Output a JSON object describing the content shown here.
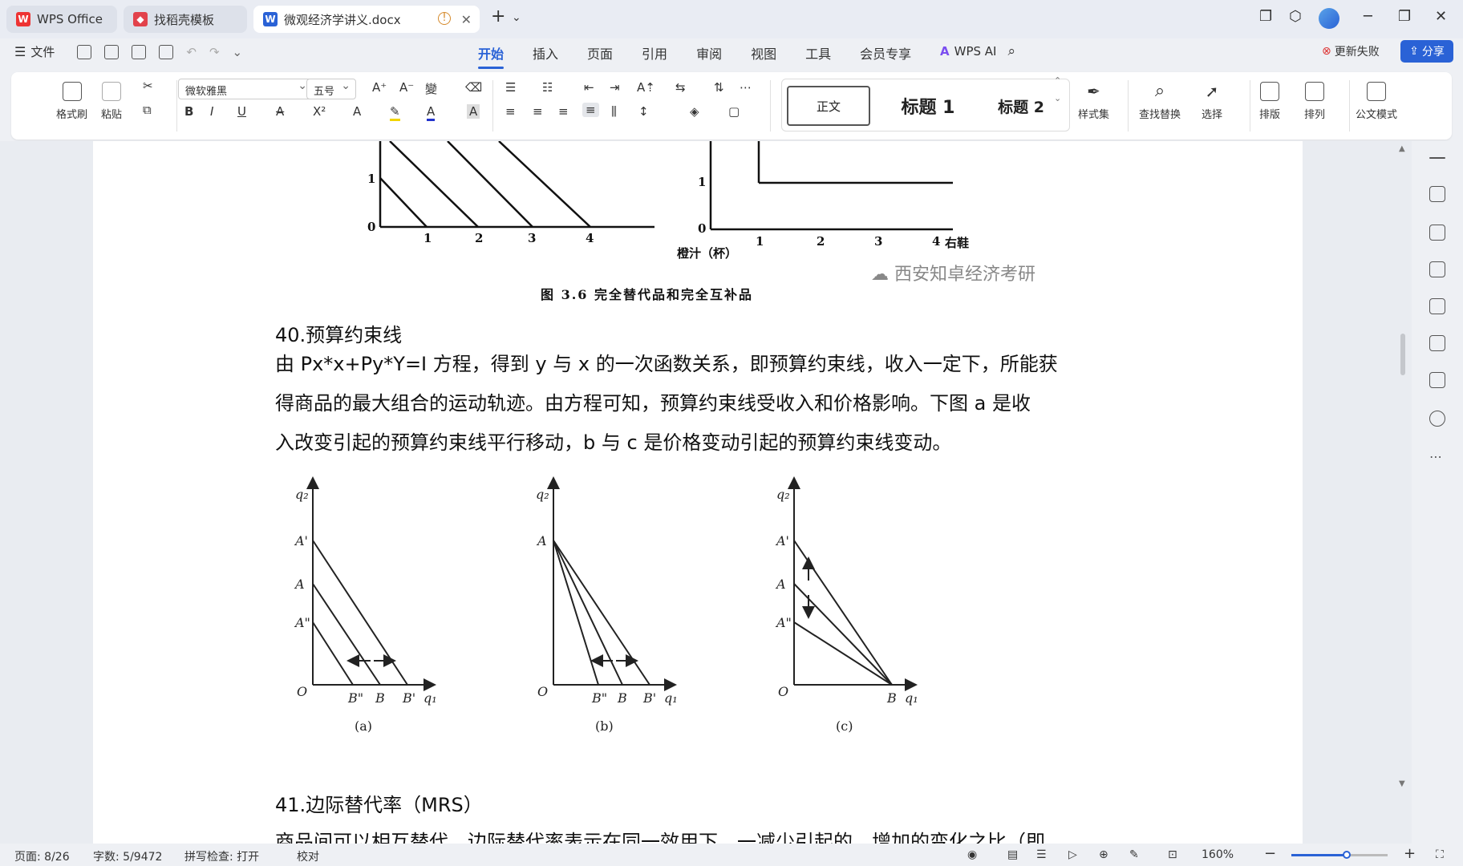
{
  "tabs": [
    {
      "label": "WPS Office"
    },
    {
      "label": "找稻壳模板"
    },
    {
      "label": "微观经济学讲义.docx"
    }
  ],
  "menu": {
    "file": "文件",
    "tabs": [
      "开始",
      "插入",
      "页面",
      "引用",
      "审阅",
      "视图",
      "工具",
      "会员专享"
    ],
    "wps_ai": "WPS AI",
    "update_fail": "更新失败",
    "share": "分享"
  },
  "ribbon": {
    "format_painter": "格式刷",
    "paste": "粘贴",
    "font_name": "微软雅黑",
    "font_size": "五号",
    "style_normal": "正文",
    "style_h1": "标题  1",
    "style_h2": "标题  2",
    "style_set": "样式集",
    "find_replace": "查找替换",
    "select": "选择",
    "layout": "排版",
    "arrange": "排列",
    "official": "公文模式"
  },
  "document": {
    "top_fig": {
      "left_y_ticks": [
        "1",
        "0"
      ],
      "left_x_ticks": [
        "1",
        "2",
        "3",
        "4"
      ],
      "left_xlabel": "橙汁（杯）",
      "right_y_ticks": [
        "1",
        "0"
      ],
      "right_x_ticks": [
        "1",
        "2",
        "3",
        "4"
      ],
      "right_xlabel": "右鞋",
      "caption": "图 3.6   完全替代品和完全互补品",
      "watermark": "西安知卓经济考研"
    },
    "heading40": "40.预算约束线",
    "para40": [
      "由 Px*x+Py*Y=I 方程，得到 y 与 x 的一次函数关系，即预算约束线，收入一定下，所能获",
      "得商品的最大组合的运动轨迹。由方程可知，预算约束线受收入和价格影响。下图 a 是收",
      "入改变引起的预算约束线平行移动，b 与 c 是价格变动引起的预算约束线变动。"
    ],
    "fig": {
      "panel_a": {
        "ylabel": "q₂",
        "xlabel": "q₁",
        "y_labels": [
          "A'",
          "A",
          "A\""
        ],
        "origin": "O",
        "x_labels": [
          "B\"",
          "B",
          "B'"
        ],
        "caption": "(a)"
      },
      "panel_b": {
        "ylabel": "q₂",
        "xlabel": "q₁",
        "y_labels": [
          "A"
        ],
        "origin": "O",
        "x_labels": [
          "B\"",
          "B",
          "B'"
        ],
        "caption": "(b)"
      },
      "panel_c": {
        "ylabel": "q₂",
        "xlabel": "q₁",
        "y_labels": [
          "A'",
          "A",
          "A\""
        ],
        "origin": "O",
        "x_labels": [
          "B"
        ],
        "caption": "(c)"
      }
    },
    "heading41": "41.边际替代率（MRS）",
    "para41_partial": "商品间可以相互替代，边际替代率表示在同一效用下，一减少引起的，增加的变化之比（即"
  },
  "status": {
    "page": "页面: 8/26",
    "words": "字数: 5/9472",
    "spell": "拼写检查: 打开",
    "proof": "校对",
    "zoom": "160%"
  }
}
